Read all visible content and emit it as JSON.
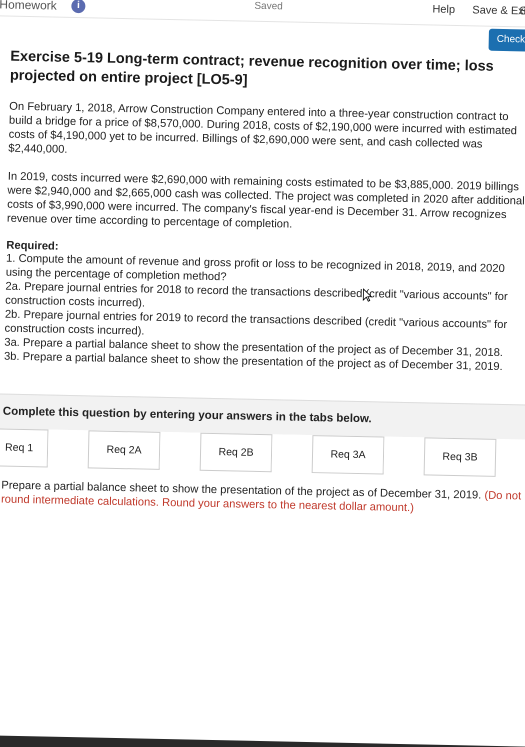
{
  "header": {
    "app_label": "Homework",
    "info_badge": "i",
    "saved_status": "Saved",
    "help": "Help",
    "save_exit": "Save & Exit",
    "submit": "Su",
    "check_button": "Check my w"
  },
  "exercise": {
    "title": "Exercise 5-19 Long-term contract; revenue recognition over time; loss projected on entire project [LO5-9]",
    "para1": "On February 1, 2018, Arrow Construction Company entered into a three-year construction contract to build a bridge for a price of $8,570,000. During 2018, costs of $2,190,000 were incurred with estimated costs of $4,190,000 yet to be incurred. Billings of $2,690,000 were sent, and cash collected was $2,440,000.",
    "para2": "In 2019, costs incurred were $2,690,000 with remaining costs estimated to be $3,885,000. 2019 billings were $2,940,000 and $2,665,000 cash was collected. The project was completed in 2020 after additional costs of $3,990,000 were incurred. The company's fiscal year-end is December 31. Arrow recognizes revenue over time according to percentage of completion.",
    "required_heading": "Required:",
    "requirements": [
      "1. Compute the amount of revenue and gross profit or loss to be recognized in 2018, 2019, and 2020 using the percentage of completion method?",
      "2a. Prepare journal entries for 2018 to record the transactions described (credit \"various accounts\" for construction costs incurred).",
      "2b. Prepare journal entries for 2019 to record the transactions described (credit \"various accounts\" for construction costs incurred).",
      "3a. Prepare a partial balance sheet to show the presentation of the project as of December 31, 2018.",
      "3b. Prepare a partial balance sheet to show the presentation of the project as of December 31, 2019."
    ]
  },
  "complete_bar": "Complete this question by entering your answers in the tabs below.",
  "tabs": [
    "Req 1",
    "Req 2A",
    "Req 2B",
    "Req 3A",
    "Req 3B"
  ],
  "instructions": {
    "main": "Prepare a partial balance sheet to show the presentation of the project as of December 31, 2019.",
    "note": "(Do not round intermediate calculations. Round your answers to the nearest dollar amount.)"
  },
  "colors": {
    "check_button": "#1c6fb0",
    "note_text": "#c0392b"
  }
}
